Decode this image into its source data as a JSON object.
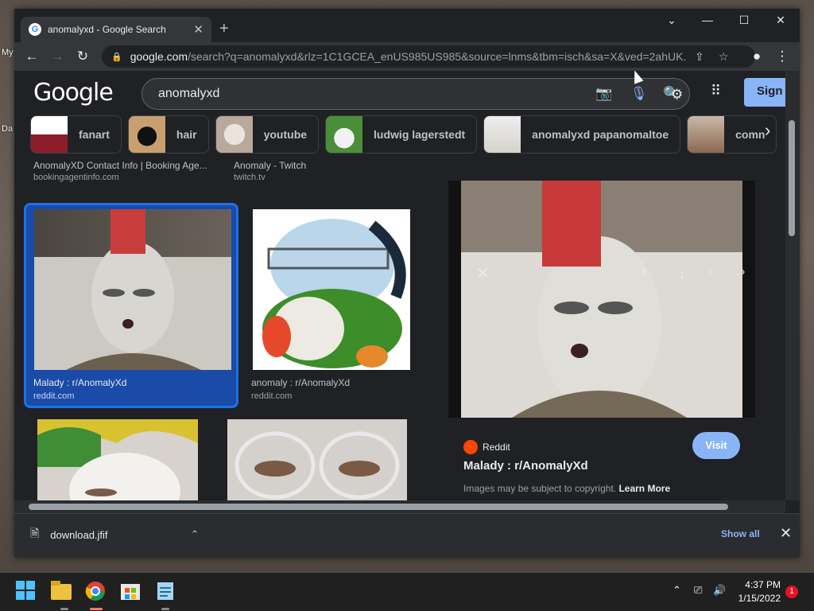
{
  "desktop": {
    "side_text_1": "My",
    "side_text_2": "Da"
  },
  "browser": {
    "tab_title": "anomalyxd - Google Search",
    "url_host": "google.com",
    "url_path": "/search?q=anomalyxd&rlz=1C1GCEA_enUS985US985&source=lnms&tbm=isch&sa=X&ved=2ahUK..."
  },
  "google": {
    "logo": "Google",
    "query": "anomalyxd",
    "sign_in": "Sign i",
    "chips": [
      "fanart",
      "hair",
      "youtube",
      "ludwig lagerstedt",
      "anomalyxd papanomaltoe",
      "comn"
    ]
  },
  "results": {
    "top_left_title": "AnomalyXD Contact Info | Booking Age...",
    "top_left_source": "bookingagentinfo.com",
    "top_right_title": "Anomaly - Twitch",
    "top_right_source": "twitch.tv",
    "card1_title": "Malady : r/AnomalyXd",
    "card1_source": "reddit.com",
    "card2_title": "anomaly : r/AnomalyXd",
    "card2_source": "reddit.com"
  },
  "preview": {
    "source": "Reddit",
    "title": "Malady : r/AnomalyXd",
    "visit_label": "Visit",
    "copyright_text": "Images may be subject to copyright.",
    "learn_more": "Learn More"
  },
  "downloads": {
    "file_name": "download.jfif",
    "show_all": "Show all"
  },
  "taskbar": {
    "time": "4:37 PM",
    "date": "1/15/2022",
    "notification_count": "1"
  }
}
